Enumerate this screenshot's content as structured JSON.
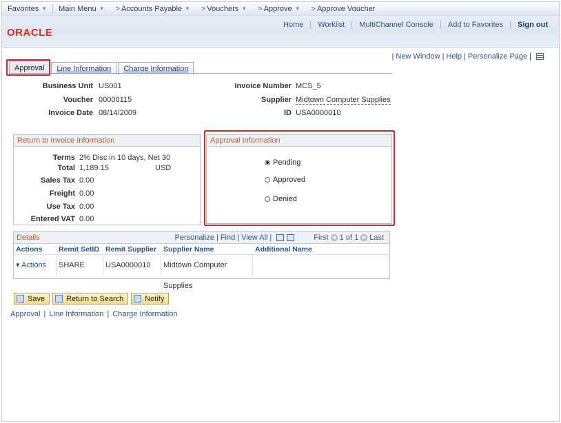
{
  "menubar": {
    "favorites": "Favorites",
    "main_menu": "Main Menu",
    "crumb1": "Accounts Payable",
    "crumb2": "Vouchers",
    "crumb3": "Approve",
    "crumb4": "Approve Voucher"
  },
  "brand": {
    "logo": "ORACLE"
  },
  "toplinks": {
    "home": "Home",
    "worklist": "Worklist",
    "multichannel": "MultiChannel Console",
    "add_fav": "Add to Favorites",
    "sign_out": "Sign out"
  },
  "pagelinks": {
    "new_window": "New Window",
    "help": "Help",
    "personalize": "Personalize Page"
  },
  "tabs": [
    {
      "label": "Approval"
    },
    {
      "label": "Line Information"
    },
    {
      "label": "Charge Information"
    }
  ],
  "fields": {
    "business_unit_label": "Business Unit",
    "business_unit": "US001",
    "voucher_label": "Voucher",
    "voucher": "00000115",
    "invoice_date_label": "Invoice Date",
    "invoice_date": "08/14/2009",
    "invoice_number_label": "Invoice Number",
    "invoice_number": "MCS_5",
    "supplier_label": "Supplier",
    "supplier": "Midtown Computer Supplies",
    "id_label": "ID",
    "id": "USA0000010"
  },
  "return_group": {
    "title": "Return to Invoice Information",
    "terms_label": "Terms",
    "terms": "2% Disc in 10 days, Net 30",
    "total_label": "Total",
    "total": "1,189.15",
    "currency": "USD",
    "sales_tax_label": "Sales Tax",
    "sales_tax": "0.00",
    "freight_label": "Freight",
    "freight": "0.00",
    "use_tax_label": "Use Tax",
    "use_tax": "0.00",
    "entered_vat_label": "Entered VAT",
    "entered_vat": "0.00"
  },
  "approval_group": {
    "title": "Approval Information",
    "pending": "Pending",
    "approved": "Approved",
    "denied": "Denied",
    "selected": "Pending"
  },
  "details": {
    "title": "Details",
    "personalize": "Personalize",
    "find": "Find",
    "view_all": "View All",
    "first": "First",
    "range": "1 of 1",
    "last": "Last",
    "columns": [
      "Actions",
      "Remit SetID",
      "Remit Supplier",
      "Supplier Name",
      "Additional Name"
    ],
    "rows": [
      {
        "actions": "Actions",
        "remit_setid": "SHARE",
        "remit_supplier": "USA0000010",
        "supplier_name": "Midtown Computer Supplies",
        "additional_name": ""
      }
    ]
  },
  "buttons": {
    "save": "Save",
    "return_search": "Return to Search",
    "notify": "Notify"
  },
  "bottomlinks": {
    "approval": "Approval",
    "line_info": "Line Information",
    "charge_info": "Charge Information"
  }
}
